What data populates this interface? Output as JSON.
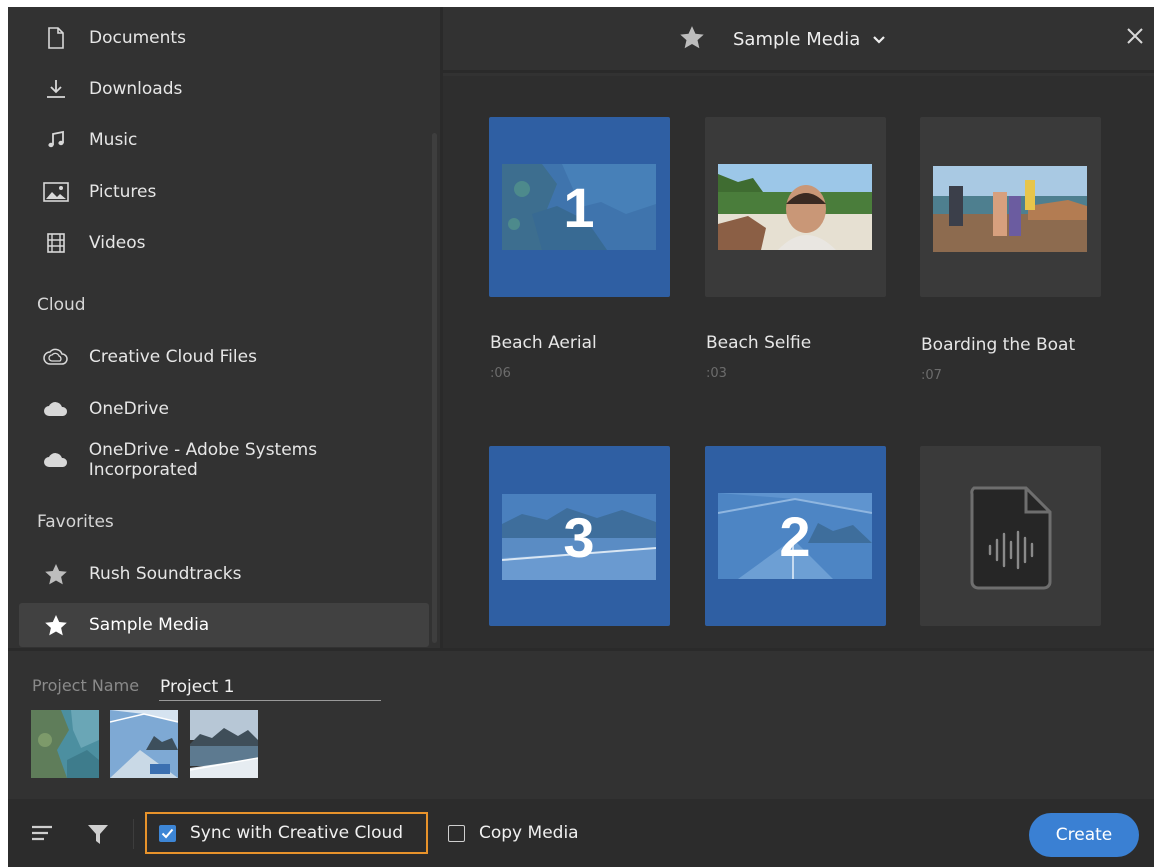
{
  "sidebar": {
    "items": [
      {
        "label": "Documents",
        "icon": "document-icon"
      },
      {
        "label": "Downloads",
        "icon": "download-icon"
      },
      {
        "label": "Music",
        "icon": "music-icon"
      },
      {
        "label": "Pictures",
        "icon": "picture-icon"
      },
      {
        "label": "Videos",
        "icon": "film-icon"
      }
    ],
    "cloud_heading": "Cloud",
    "cloud_items": [
      {
        "label": "Creative Cloud Files",
        "icon": "creative-cloud-icon"
      },
      {
        "label": "OneDrive",
        "icon": "cloud-icon"
      },
      {
        "label": "OneDrive - Adobe Systems Incorporated",
        "icon": "cloud-icon"
      }
    ],
    "favorites_heading": "Favorites",
    "favorite_items": [
      {
        "label": "Rush Soundtracks",
        "icon": "star-icon"
      },
      {
        "label": "Sample Media",
        "icon": "star-icon",
        "active": true
      }
    ]
  },
  "media_header": {
    "title": "Sample Media"
  },
  "media": {
    "tiles": [
      {
        "label": "Beach Aerial",
        "duration": ":06",
        "selected": true,
        "order": "1"
      },
      {
        "label": "Beach Selfie",
        "duration": ":03",
        "selected": false
      },
      {
        "label": "Boarding the Boat",
        "duration": ":07",
        "selected": false
      },
      {
        "selected": true,
        "order": "3"
      },
      {
        "selected": true,
        "order": "2"
      },
      {
        "selected": false,
        "type": "audio"
      }
    ]
  },
  "project": {
    "name_label": "Project Name",
    "name_value": "Project 1"
  },
  "footer": {
    "sync_label": "Sync with Creative Cloud",
    "sync_checked": true,
    "copy_label": "Copy Media",
    "copy_checked": false,
    "create_label": "Create"
  },
  "colors": {
    "accent": "#3a80d3",
    "selection": "#2f5fa3",
    "highlight_border": "#e8932b",
    "panel": "#323232"
  }
}
